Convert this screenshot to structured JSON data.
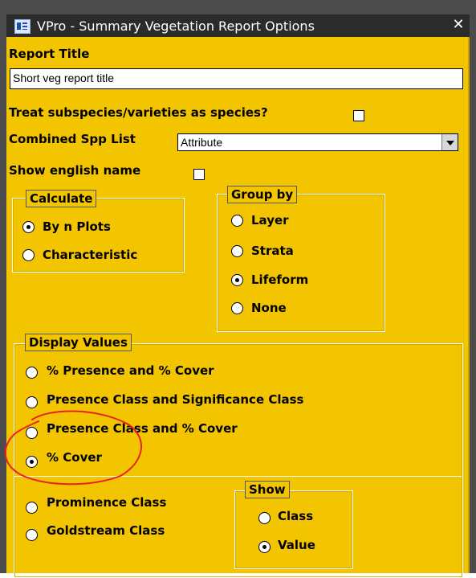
{
  "window": {
    "title": "VPro - Summary Vegetation Report Options",
    "close_glyph": "✕"
  },
  "report_title": {
    "label": "Report Title",
    "value": "Short veg report title"
  },
  "treat_subspecies": {
    "label": "Treat subspecies/varieties as species?",
    "checked": false
  },
  "combined_spp": {
    "label": "Combined Spp List",
    "value": "Attribute"
  },
  "show_english": {
    "label": "Show english name",
    "checked": false
  },
  "calculate": {
    "legend": "Calculate",
    "options": [
      "By n Plots",
      "Characteristic"
    ],
    "selected": "By n Plots"
  },
  "group_by": {
    "legend": "Group by",
    "options": [
      "Layer",
      "Strata",
      "Lifeform",
      "None"
    ],
    "selected": "Lifeform"
  },
  "display_values": {
    "legend": "Display Values",
    "options": [
      "% Presence and % Cover",
      "Presence Class and Significance Class",
      "Presence Class and % Cover",
      "% Cover",
      "Prominence Class",
      "Goldstream Class"
    ],
    "selected": "% Cover"
  },
  "show": {
    "legend": "Show",
    "options": [
      "Class",
      "Value"
    ],
    "selected": "Value"
  },
  "annotation": {
    "color": "#e8231f"
  }
}
